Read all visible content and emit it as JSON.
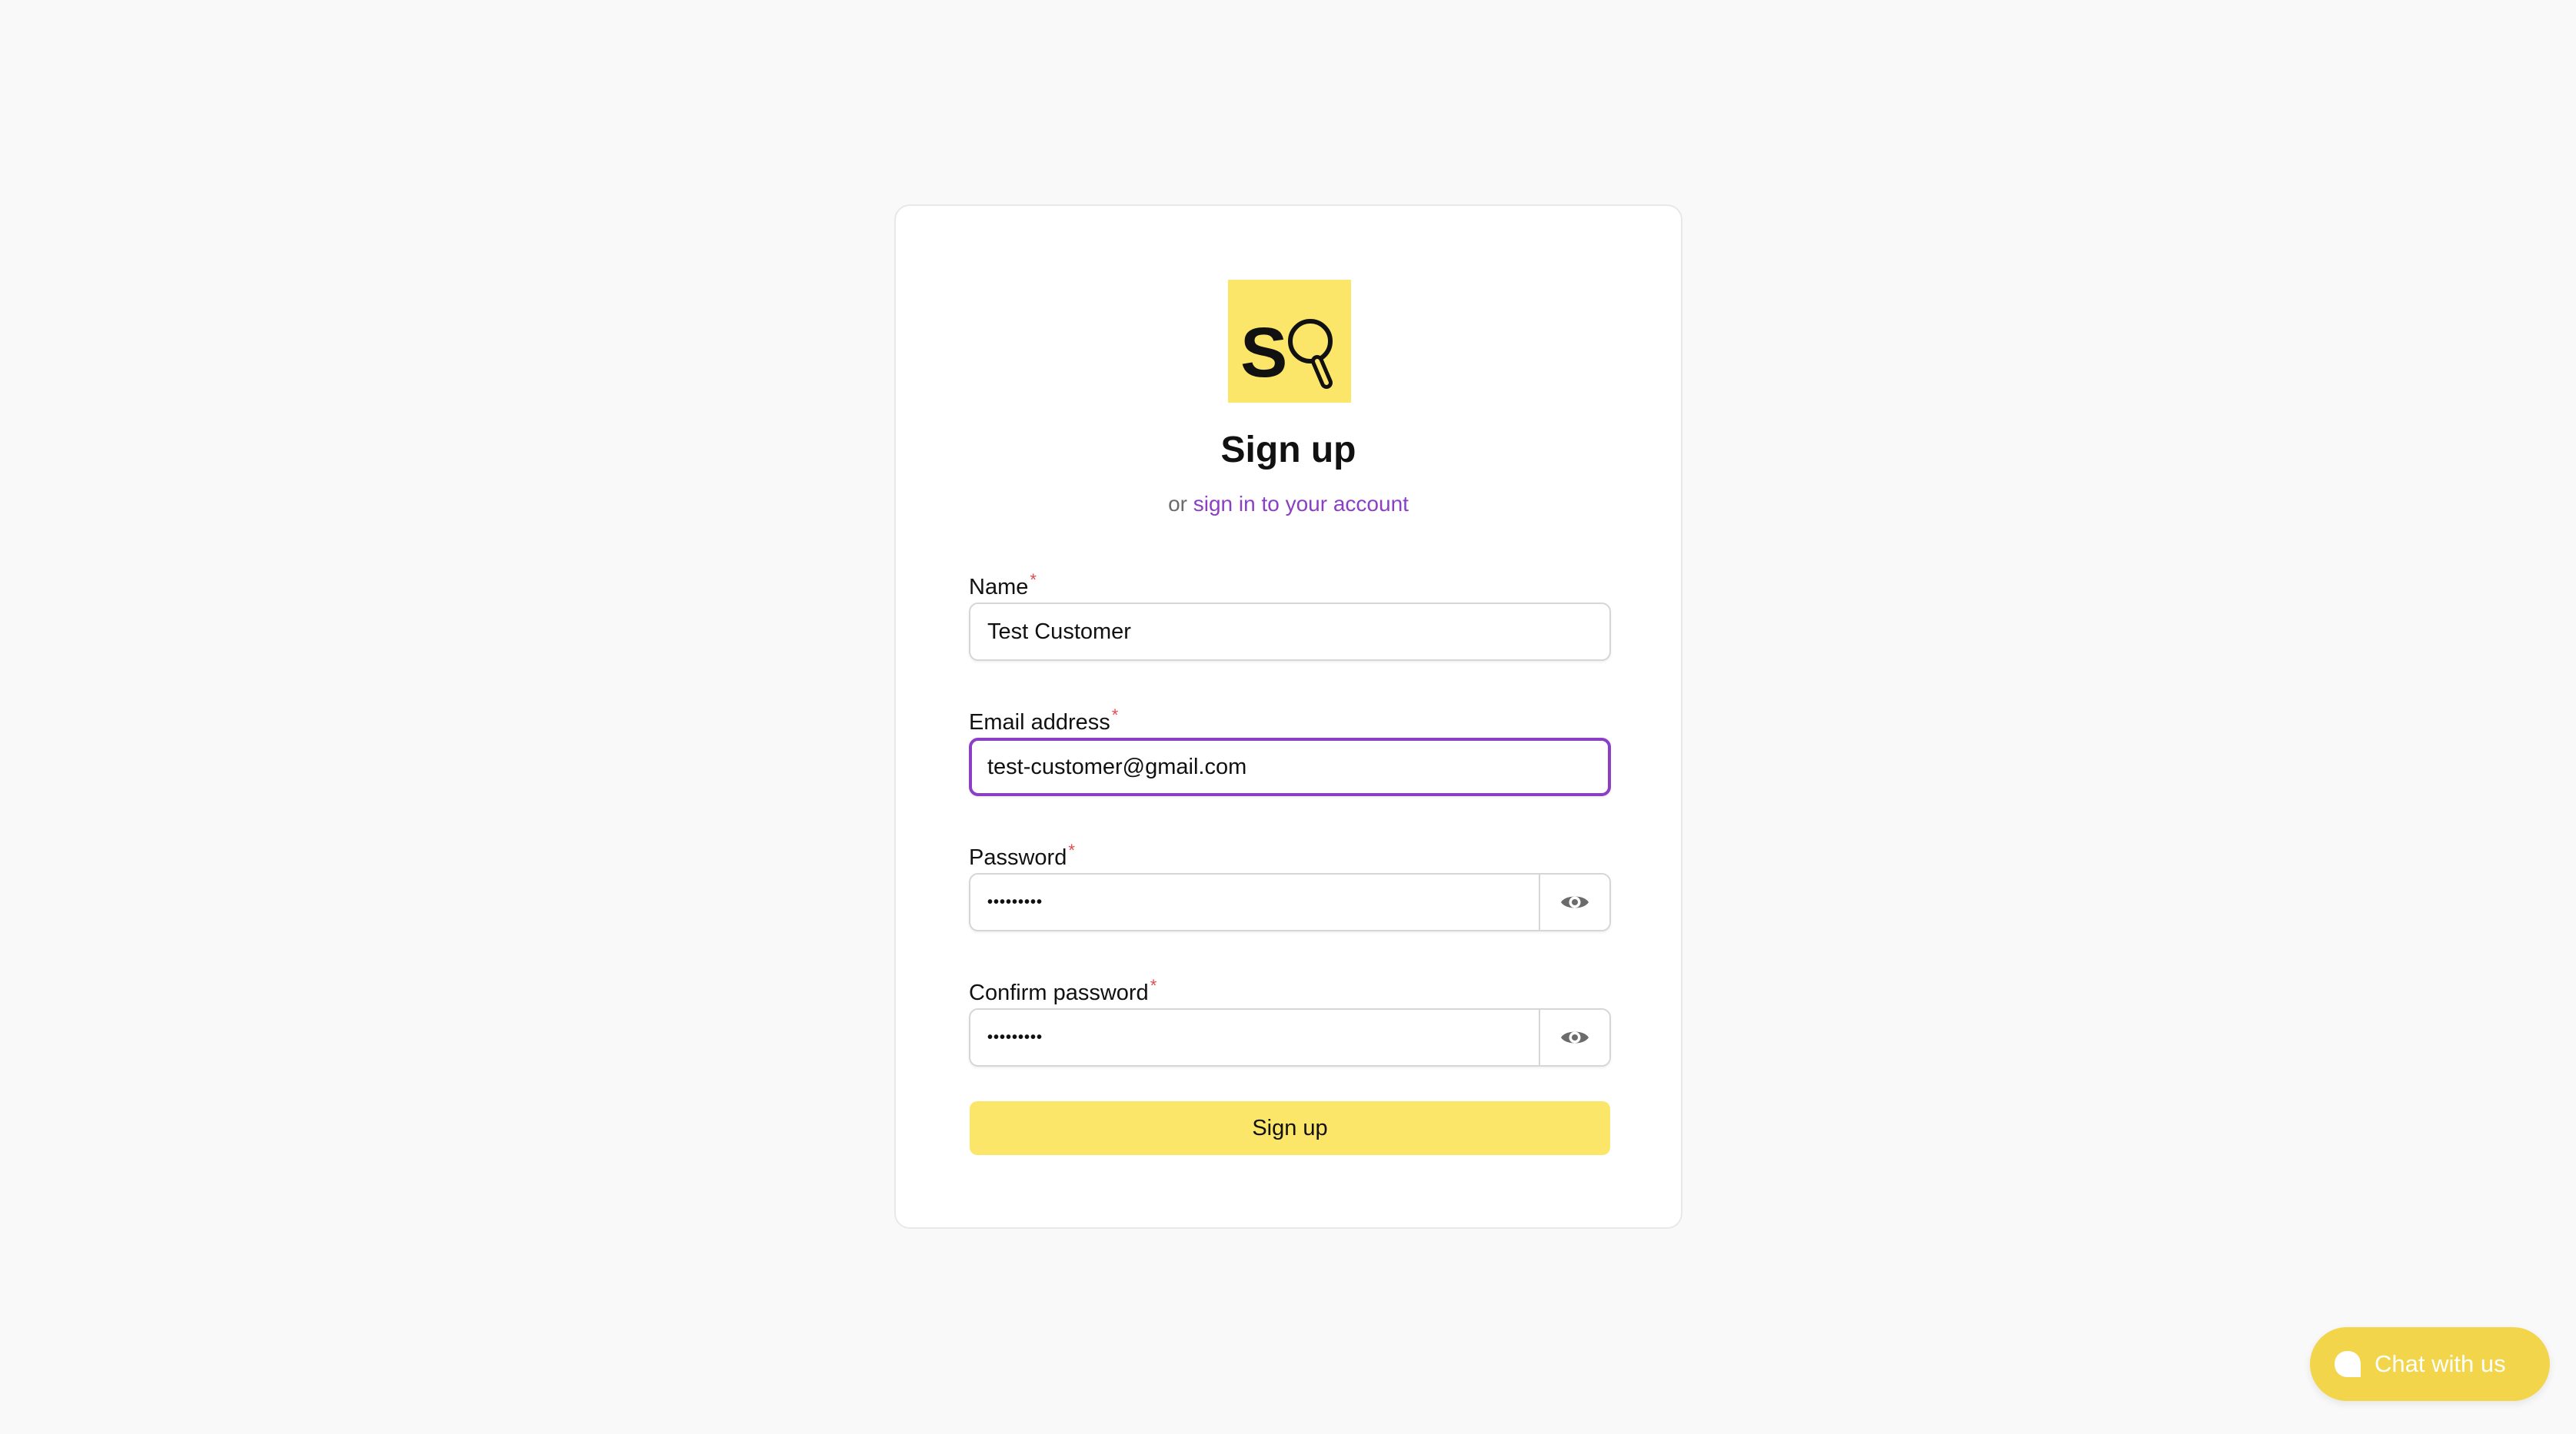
{
  "brand": {
    "logo_letter": "S",
    "accent_color": "#fbe669",
    "link_color": "#8b3fc4"
  },
  "page": {
    "title": "Sign up",
    "subtitle_prefix": "or ",
    "signin_link": "sign in to your account"
  },
  "form": {
    "required_mark": "*",
    "name": {
      "label": "Name",
      "value": "Test Customer"
    },
    "email": {
      "label": "Email address",
      "value": "test-customer@gmail.com"
    },
    "password": {
      "label": "Password",
      "masked_value": "•••••••••",
      "toggle_icon": "eye-icon"
    },
    "confirm_password": {
      "label": "Confirm password",
      "masked_value": "•••••••••",
      "toggle_icon": "eye-icon"
    },
    "submit_label": "Sign up"
  },
  "chat_widget": {
    "label": "Chat with us",
    "icon": "chat-bubble-icon",
    "color": "#f3d54b"
  }
}
